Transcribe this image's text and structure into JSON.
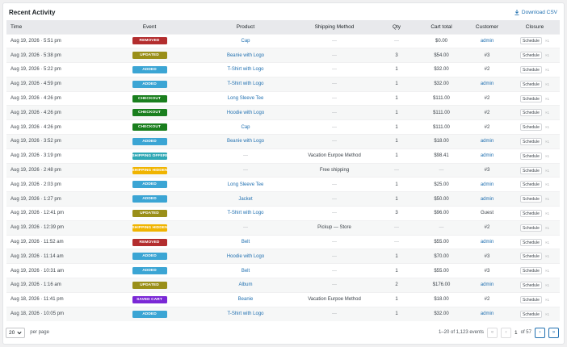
{
  "title": "Recent Activity",
  "download_label": "Download CSV",
  "colors": {
    "removed": "#b32d2e",
    "updated": "#9a8f19",
    "added": "#3ba5d4",
    "checkout": "#1a7f1e",
    "shipping_offered": "#2fa8b5",
    "shipping_hidden": "#f0b400",
    "saved_cart": "#7a28d6",
    "link": "#2271b1"
  },
  "columns": [
    "Time",
    "Event",
    "Product",
    "Shipping Method",
    "Qty",
    "Cart total",
    "Customer",
    "Closure"
  ],
  "rows": [
    {
      "time": "Aug 19, 2026 · 5:51 pm",
      "event": "REMOVED",
      "event_type": "removed",
      "product": "Cap",
      "shipping": "—",
      "qty": "—",
      "total": "$0.00",
      "customer": "admin",
      "customer_link": true
    },
    {
      "time": "Aug 19, 2026 · 5:38 pm",
      "event": "UPDATED",
      "event_type": "updated",
      "product": "Beanie with Logo",
      "shipping": "—",
      "qty": "3",
      "total": "$54.00",
      "customer": "#3",
      "customer_link": false
    },
    {
      "time": "Aug 19, 2026 · 5:22 pm",
      "event": "ADDED",
      "event_type": "added",
      "product": "T-Shirt with Logo",
      "shipping": "—",
      "qty": "1",
      "total": "$32.00",
      "customer": "#2",
      "customer_link": false
    },
    {
      "time": "Aug 19, 2026 · 4:59 pm",
      "event": "ADDED",
      "event_type": "added",
      "product": "T-Shirt with Logo",
      "shipping": "—",
      "qty": "1",
      "total": "$32.00",
      "customer": "admin",
      "customer_link": true
    },
    {
      "time": "Aug 19, 2026 · 4:26 pm",
      "event": "CHECKOUT",
      "event_type": "checkout",
      "product": "Long Sleeve Tee",
      "shipping": "—",
      "qty": "1",
      "total": "$111.00",
      "customer": "#2",
      "customer_link": false
    },
    {
      "time": "Aug 19, 2026 · 4:26 pm",
      "event": "CHECKOUT",
      "event_type": "checkout",
      "product": "Hoodie with Logo",
      "shipping": "—",
      "qty": "1",
      "total": "$111.00",
      "customer": "#2",
      "customer_link": false
    },
    {
      "time": "Aug 19, 2026 · 4:26 pm",
      "event": "CHECKOUT",
      "event_type": "checkout",
      "product": "Cap",
      "shipping": "—",
      "qty": "1",
      "total": "$111.00",
      "customer": "#2",
      "customer_link": false
    },
    {
      "time": "Aug 19, 2026 · 3:52 pm",
      "event": "ADDED",
      "event_type": "added",
      "product": "Beanie with Logo",
      "shipping": "—",
      "qty": "1",
      "total": "$18.00",
      "customer": "admin",
      "customer_link": true
    },
    {
      "time": "Aug 19, 2026 · 3:19 pm",
      "event": "SHIPPING OFFERED",
      "event_type": "shipping_offered",
      "product": "—",
      "shipping": "Vacation Eurpoe Method",
      "qty": "1",
      "total": "$98.41",
      "customer": "admin",
      "customer_link": true
    },
    {
      "time": "Aug 19, 2026 · 2:48 pm",
      "event": "SHIPPING HIDDEN",
      "event_type": "shipping_hidden",
      "product": "—",
      "shipping": "Free shipping",
      "qty": "—",
      "total": "—",
      "customer": "#3",
      "customer_link": false
    },
    {
      "time": "Aug 19, 2026 · 2:03 pm",
      "event": "ADDED",
      "event_type": "added",
      "product": "Long Sleeve Tee",
      "shipping": "—",
      "qty": "1",
      "total": "$25.00",
      "customer": "admin",
      "customer_link": true
    },
    {
      "time": "Aug 19, 2026 · 1:27 pm",
      "event": "ADDED",
      "event_type": "added",
      "product": "Jacket",
      "shipping": "—",
      "qty": "1",
      "total": "$50.00",
      "customer": "admin",
      "customer_link": true
    },
    {
      "time": "Aug 19, 2026 · 12:41 pm",
      "event": "UPDATED",
      "event_type": "updated",
      "product": "T-Shirt with Logo",
      "shipping": "—",
      "qty": "3",
      "total": "$96.00",
      "customer": "Guest",
      "customer_link": false
    },
    {
      "time": "Aug 19, 2026 · 12:39 pm",
      "event": "SHIPPING HIDDEN",
      "event_type": "shipping_hidden",
      "product": "—",
      "shipping": "Pickup — Store",
      "qty": "—",
      "total": "—",
      "customer": "#2",
      "customer_link": false
    },
    {
      "time": "Aug 19, 2026 · 11:52 am",
      "event": "REMOVED",
      "event_type": "removed",
      "product": "Belt",
      "shipping": "—",
      "qty": "—",
      "total": "$55.00",
      "customer": "admin",
      "customer_link": true
    },
    {
      "time": "Aug 19, 2026 · 11:14 am",
      "event": "ADDED",
      "event_type": "added",
      "product": "Hoodie with Logo",
      "shipping": "—",
      "qty": "1",
      "total": "$70.00",
      "customer": "#3",
      "customer_link": false
    },
    {
      "time": "Aug 19, 2026 · 10:31 am",
      "event": "ADDED",
      "event_type": "added",
      "product": "Belt",
      "shipping": "—",
      "qty": "1",
      "total": "$55.00",
      "customer": "#3",
      "customer_link": false
    },
    {
      "time": "Aug 19, 2026 · 1:16 am",
      "event": "UPDATED",
      "event_type": "updated",
      "product": "Album",
      "shipping": "—",
      "qty": "2",
      "total": "$176.00",
      "customer": "admin",
      "customer_link": true
    },
    {
      "time": "Aug 18, 2026 · 11:41 pm",
      "event": "SAVED CART",
      "event_type": "saved_cart",
      "product": "Beanie",
      "shipping": "Vacation Eurpoe Method",
      "qty": "1",
      "total": "$18.00",
      "customer": "#2",
      "customer_link": false
    },
    {
      "time": "Aug 18, 2026 · 10:05 pm",
      "event": "ADDED",
      "event_type": "added",
      "product": "T-Shirt with Logo",
      "shipping": "—",
      "qty": "1",
      "total": "$32.00",
      "customer": "admin",
      "customer_link": true
    }
  ],
  "schedule_label": "Schedule",
  "close_label": "×1",
  "footer": {
    "per_page_value": "20",
    "per_page_label": "per page",
    "range_text": "1–20 of 1,123 events",
    "first": "«",
    "prev": "‹",
    "current_page": "1",
    "of_pages": "of 57",
    "next": "›",
    "last": "»"
  }
}
